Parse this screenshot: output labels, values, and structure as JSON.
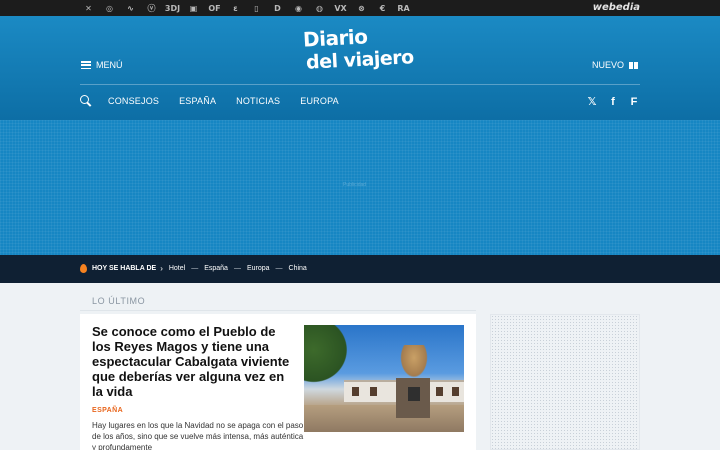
{
  "network": {
    "icons": [
      "xataka-icon",
      "applesfera-icon",
      "genbeta-icon",
      "vidaextra-icon",
      "3djuegos-icon",
      "espinof-icon",
      "compradiccion-icon",
      "xatakamovil-icon",
      "directo-icon",
      "motorpasion-icon",
      "applesfera2-icon",
      "vitonica-icon",
      "vayatele-icon",
      "trendencias-icon",
      "el-blog-salmon-icon",
      "pequerecetas-icon"
    ],
    "glyphs": [
      "✕",
      "◎",
      "∿",
      "ⓥ",
      "3DJ",
      "▣",
      "OF",
      "ɛ",
      "▯",
      "D",
      "◉",
      "◍",
      "VX",
      "⊗",
      "€",
      "RA"
    ],
    "brand": "webedia"
  },
  "header": {
    "menu_label": "MENÚ",
    "logo_line1": "Diario",
    "logo_line2": "del viajero",
    "nuevo_label": "NUEVO",
    "nav": [
      "CONSEJOS",
      "ESPAÑA",
      "NOTICIAS",
      "EUROPA"
    ],
    "social": [
      {
        "name": "x-icon",
        "glyph": "𝕏"
      },
      {
        "name": "facebook-icon",
        "glyph": "f"
      },
      {
        "name": "flipboard-icon",
        "glyph": "F"
      }
    ]
  },
  "ad": {
    "label": "Publicidad"
  },
  "trending": {
    "title": "HOY SE HABLA DE",
    "links": [
      "Hotel",
      "España",
      "Europa",
      "China"
    ]
  },
  "main": {
    "section_title": "LO ÚLTIMO",
    "article": {
      "title": "Se conoce como el Pueblo de los Reyes Magos y tiene una espectacular Cabalgata viviente que deberías ver alguna vez en la vida",
      "category": "ESPAÑA",
      "description": "Hay lugares en los que la Navidad no se apaga con el paso de los años, sino que se vuelve más intensa, más auténtica y profundamente"
    }
  },
  "colors": {
    "header": "#1b8ac4",
    "trend_bar": "#0f2033",
    "category": "#e8651c"
  }
}
